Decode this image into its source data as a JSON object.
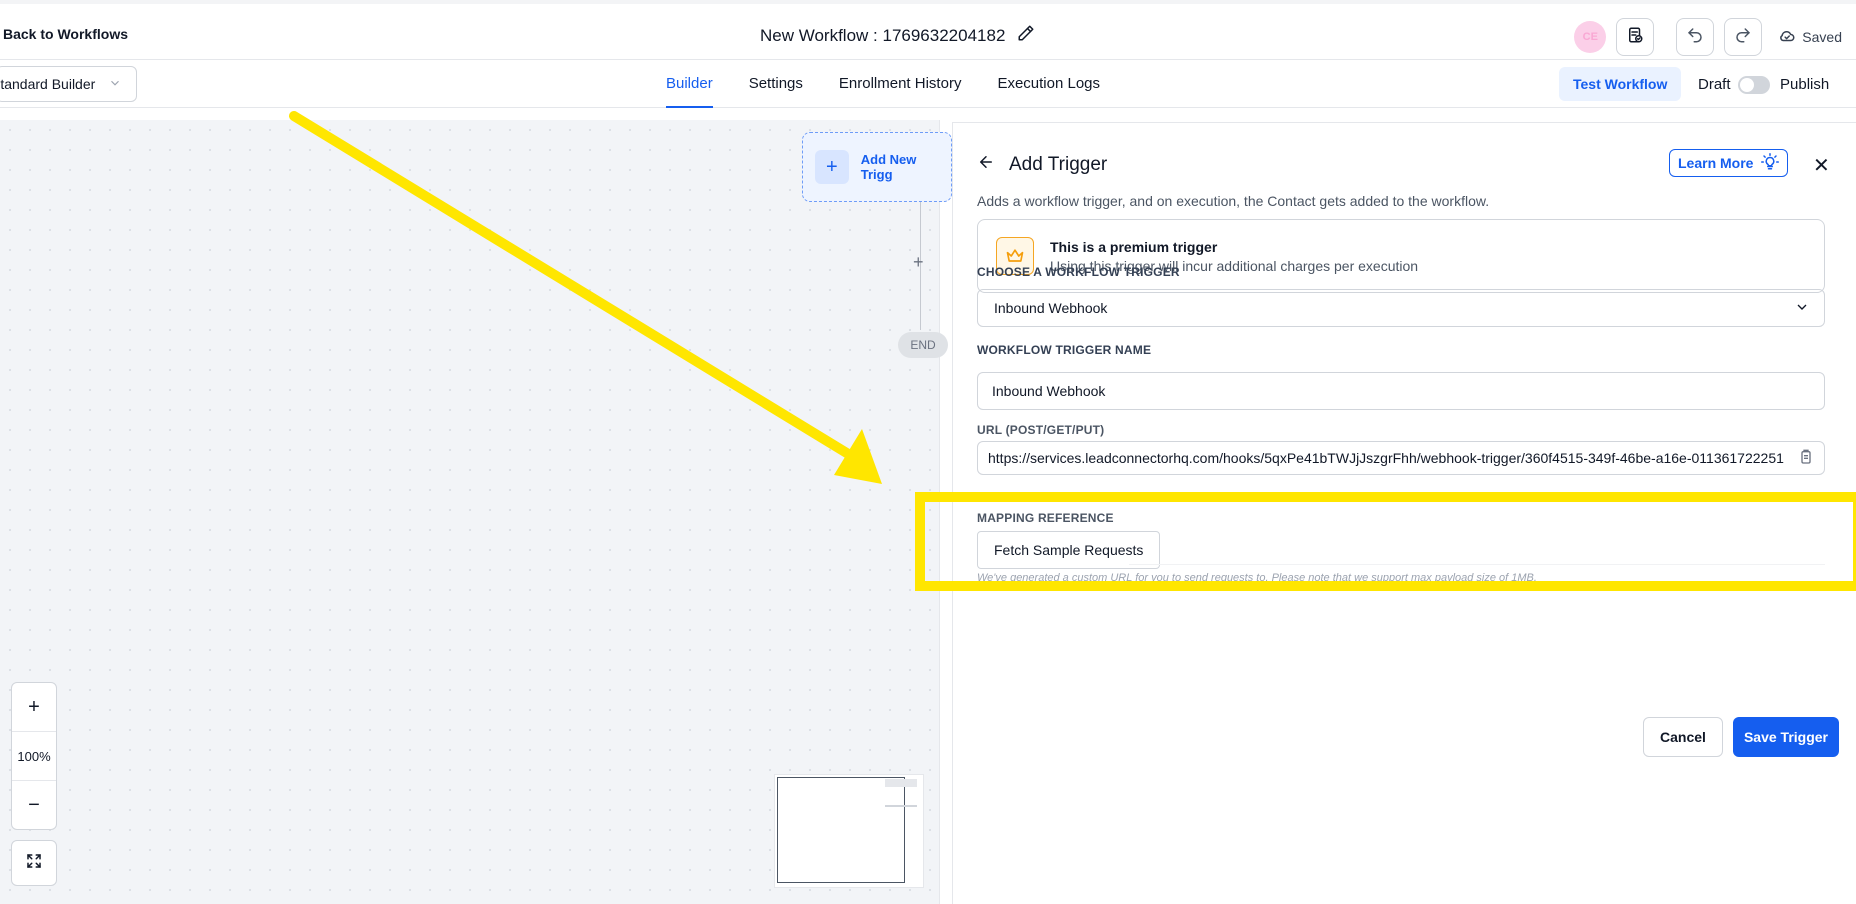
{
  "header": {
    "back_label": "Back to Workflows",
    "workflow_title": "New Workflow : 1769632204182",
    "avatar_initials": "CE",
    "saved_label": "Saved"
  },
  "subnav": {
    "builder_select": "Standard Builder",
    "tabs": [
      {
        "label": "Builder",
        "active": true
      },
      {
        "label": "Settings",
        "active": false
      },
      {
        "label": "Enrollment History",
        "active": false
      },
      {
        "label": "Execution Logs",
        "active": false
      }
    ],
    "test_label": "Test Workflow",
    "draft_label": "Draft",
    "publish_label": "Publish",
    "publish_enabled": false
  },
  "canvas": {
    "add_trigger_label": "Add New Trigg",
    "end_label": "END",
    "zoom_level": "100%",
    "zoom_in": "+",
    "zoom_out": "−",
    "step_add": "+"
  },
  "panel": {
    "title": "Add Trigger",
    "learn_more": "Learn More",
    "close": "✕",
    "description": "Adds a workflow trigger, and on execution, the Contact gets added to the workflow.",
    "premium_title": "This is a premium trigger",
    "premium_subtitle": "Using this trigger will incur additional charges per execution",
    "choose_label": "CHOOSE A WORKFLOW TRIGGER",
    "trigger_selected": "Inbound Webhook",
    "name_label": "WORKFLOW TRIGGER NAME",
    "name_value": "Inbound Webhook",
    "url_label": "URL (POST/GET/PUT)",
    "url_value": "https://services.leadconnectorhq.com/hooks/5qxPe41bTWJjJszgrFhh/webhook-trigger/360f4515-349f-46be-a16e-011361722251",
    "url_hint": "We've generated a custom URL for you to send requests to. Please note that we support max payload size of 1MB.",
    "mapping_label": "MAPPING REFERENCE",
    "fetch_label": "Fetch Sample Requests",
    "cancel_label": "Cancel",
    "save_label": "Save Trigger"
  },
  "colors": {
    "accent": "#155eef",
    "annotation": "#ffe600"
  }
}
